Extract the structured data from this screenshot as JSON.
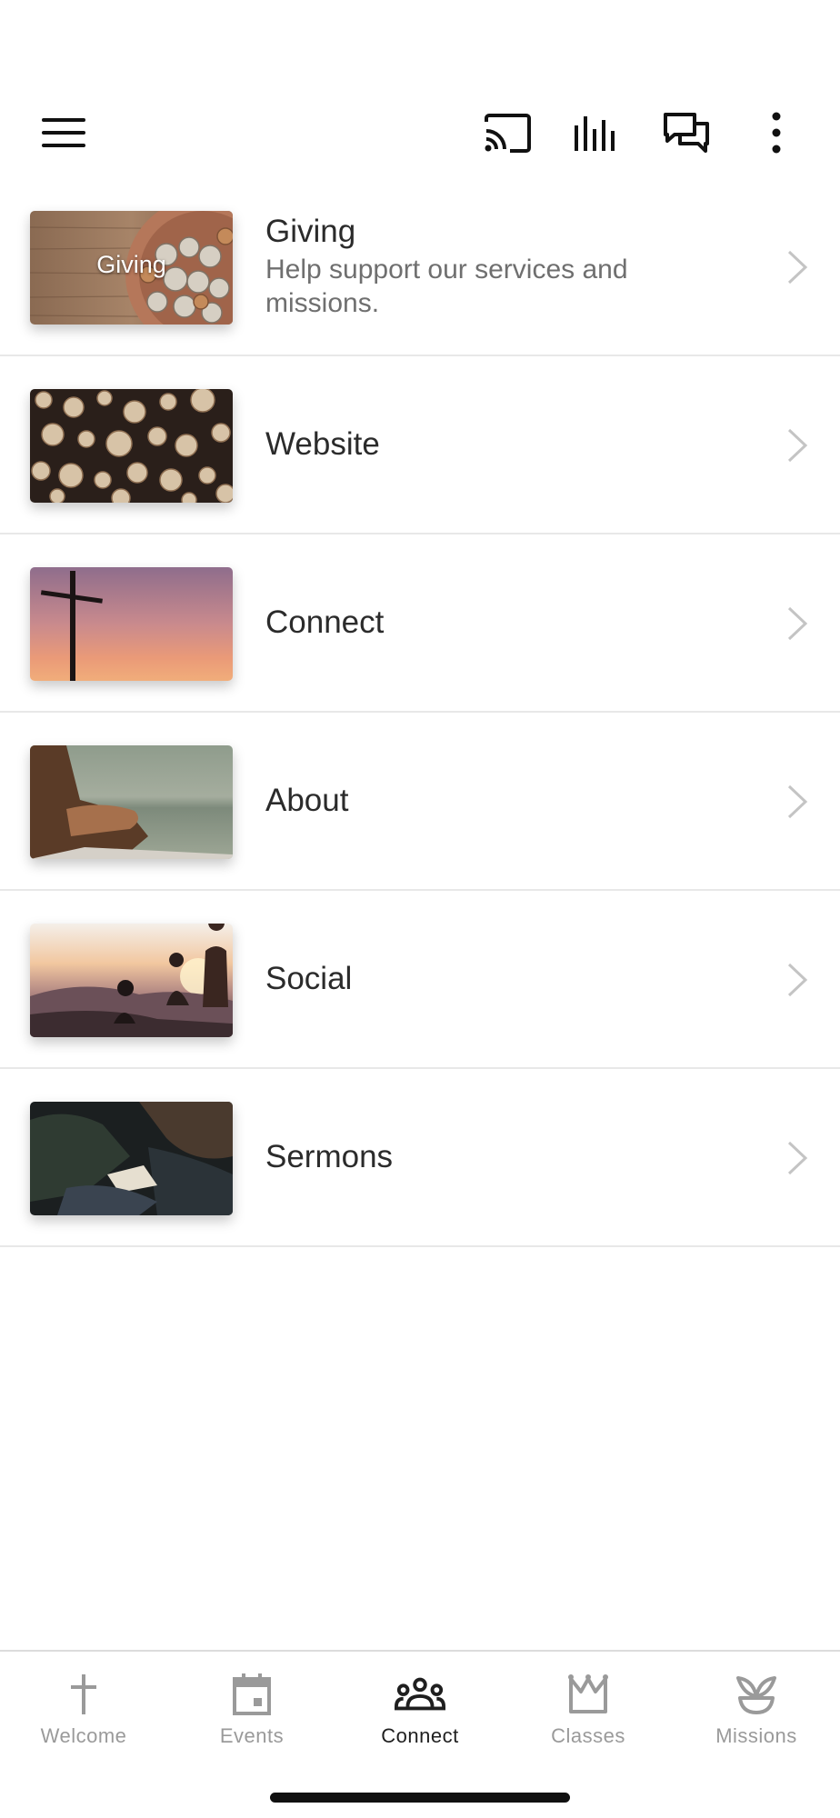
{
  "toolbar": {
    "icons": [
      "menu-icon",
      "cast-icon",
      "audio-bars-icon",
      "chat-icon",
      "more-vertical-icon"
    ]
  },
  "list": {
    "items": [
      {
        "title": "Giving",
        "subtitle": "Help support our services and missions.",
        "thumb_label": "Giving",
        "thumb": "giving-coins-image"
      },
      {
        "title": "Website",
        "subtitle": "",
        "thumb": "stacked-logs-image"
      },
      {
        "title": "Connect",
        "subtitle": "",
        "thumb": "cross-sunset-image"
      },
      {
        "title": "About",
        "subtitle": "",
        "thumb": "praying-hands-lake-image"
      },
      {
        "title": "Social",
        "subtitle": "",
        "thumb": "people-mountain-sunset-image"
      },
      {
        "title": "Sermons",
        "subtitle": "",
        "thumb": "congregation-bible-image"
      }
    ]
  },
  "bottom_nav": {
    "active": "Connect",
    "items": [
      {
        "label": "Welcome",
        "icon": "cross-icon"
      },
      {
        "label": "Events",
        "icon": "calendar-icon"
      },
      {
        "label": "Connect",
        "icon": "group-icon"
      },
      {
        "label": "Classes",
        "icon": "crown-icon"
      },
      {
        "label": "Missions",
        "icon": "plant-icon"
      }
    ]
  },
  "colors": {
    "text_primary": "#2b2b2b",
    "text_secondary": "#6f6f6f",
    "nav_inactive": "#9a9a9a",
    "nav_active": "#1f1f1f",
    "divider": "#e8e8e8"
  }
}
